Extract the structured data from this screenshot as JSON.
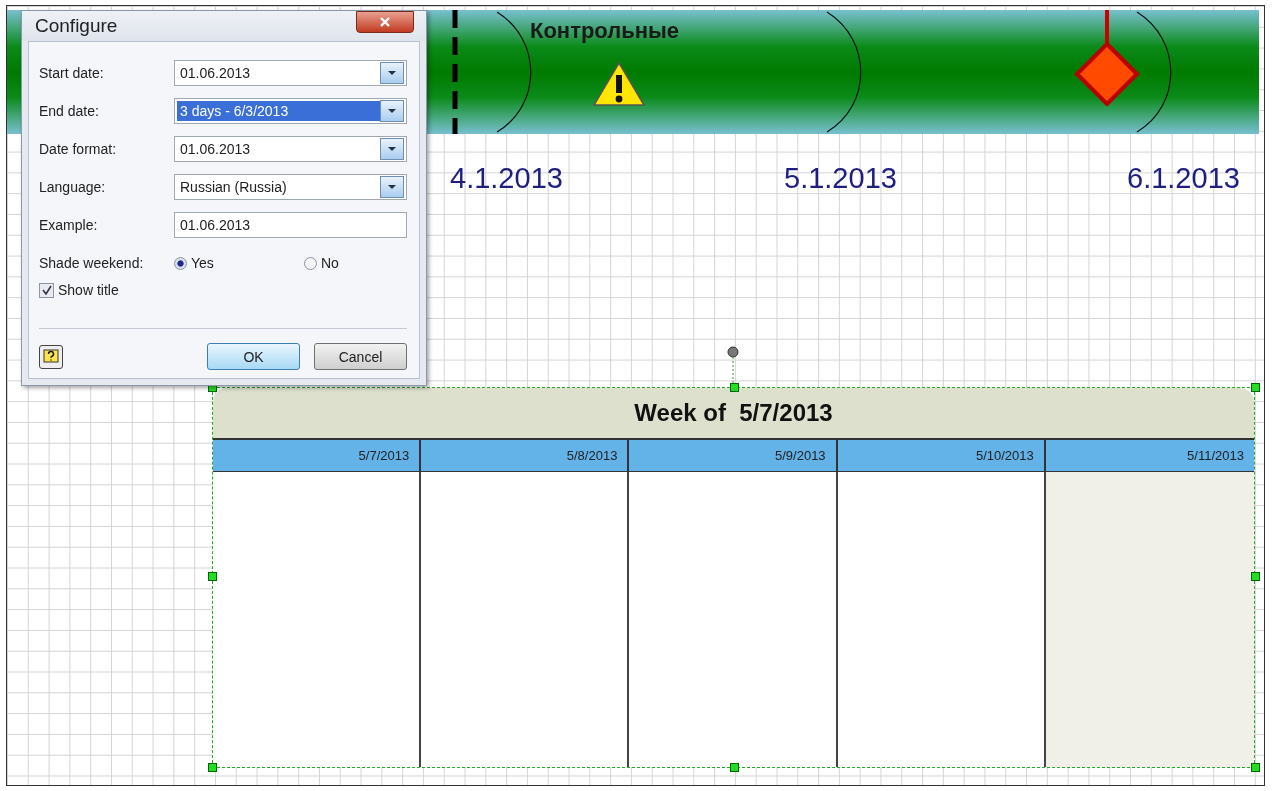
{
  "timeline": {
    "title": "Контрольные",
    "dates": [
      "4.1.2013",
      "5.1.2013",
      "6.1.2013"
    ]
  },
  "calendar": {
    "title": "Week of  5/7/2013",
    "days": [
      {
        "date": "5/7/2013",
        "shaded": false
      },
      {
        "date": "5/8/2013",
        "shaded": false
      },
      {
        "date": "5/9/2013",
        "shaded": false
      },
      {
        "date": "5/10/2013",
        "shaded": false
      },
      {
        "date": "5/11/2013",
        "shaded": true
      }
    ]
  },
  "dialog": {
    "title": "Configure",
    "fields": [
      {
        "label": "Start date:",
        "value": "01.06.2013",
        "kind": "dropdown",
        "selected": false
      },
      {
        "label": "End date:",
        "value": "3 days - 6/3/2013",
        "kind": "dropdown",
        "selected": true
      },
      {
        "label": "Date format:",
        "value": "01.06.2013",
        "kind": "dropdown",
        "selected": false
      },
      {
        "label": "Language:",
        "value": "Russian (Russia)",
        "kind": "dropdown",
        "selected": false
      },
      {
        "label": "Example:",
        "value": "01.06.2013",
        "kind": "text",
        "selected": false
      }
    ],
    "shade_weekend": {
      "label": "Shade weekend:",
      "options": [
        {
          "label": "Yes",
          "selected": true
        },
        {
          "label": "No",
          "selected": false
        }
      ]
    },
    "show_title": {
      "label": "Show title",
      "checked": true
    },
    "buttons": [
      "OK",
      "Cancel"
    ]
  }
}
